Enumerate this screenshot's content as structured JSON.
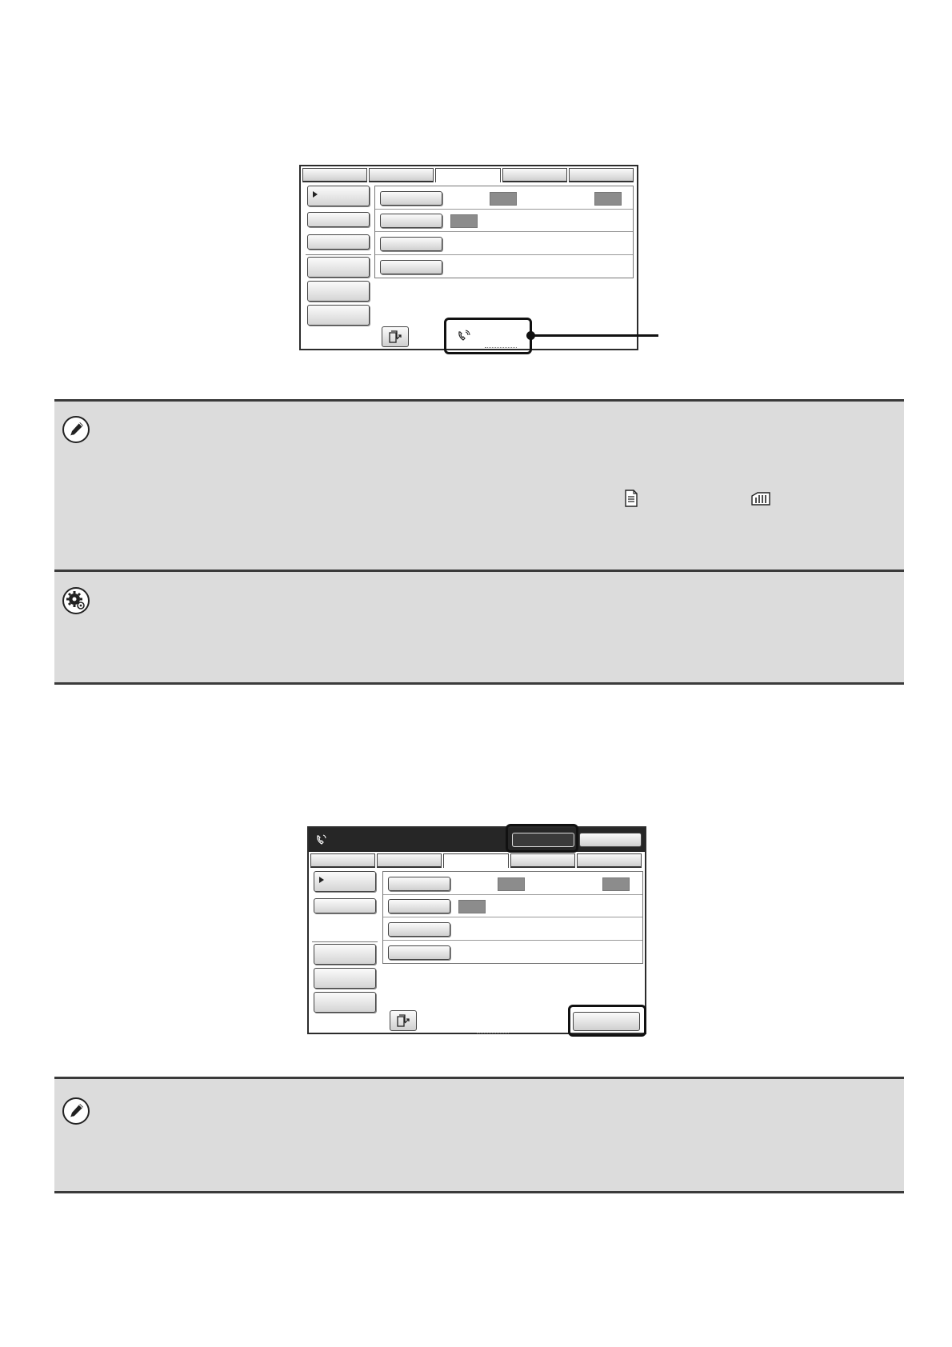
{
  "screen1": {
    "tabs": [
      "",
      "",
      "",
      "",
      ""
    ],
    "active_tab": 2,
    "side_buttons": [
      "",
      "",
      "",
      "",
      "",
      ""
    ],
    "panel_rows": [
      "",
      "",
      "",
      ""
    ],
    "icons": {
      "bottom_button": "document-send-icon",
      "status": "phone-line-icon"
    }
  },
  "note1": {
    "icon": "pencil-note-icon",
    "inline_icons": [
      "document-icon",
      "memory-meter-icon"
    ]
  },
  "note2": {
    "icon": "system-settings-gear-icon"
  },
  "screen2": {
    "header_icon": "phone-line-icon",
    "tabs": [
      "",
      "",
      "",
      "",
      ""
    ],
    "active_tab": 2,
    "side_buttons": [
      "",
      "",
      "",
      "",
      ""
    ],
    "panel_rows": [
      "",
      "",
      "",
      ""
    ],
    "icons": {
      "bottom_button": "document-send-icon"
    }
  },
  "note3": {
    "icon": "pencil-note-icon"
  },
  "colors": {
    "box_background": "#dcdcdc",
    "rule": "#3a3a3a",
    "screen_header": "#262626",
    "value_box": "#8c8c8c"
  }
}
